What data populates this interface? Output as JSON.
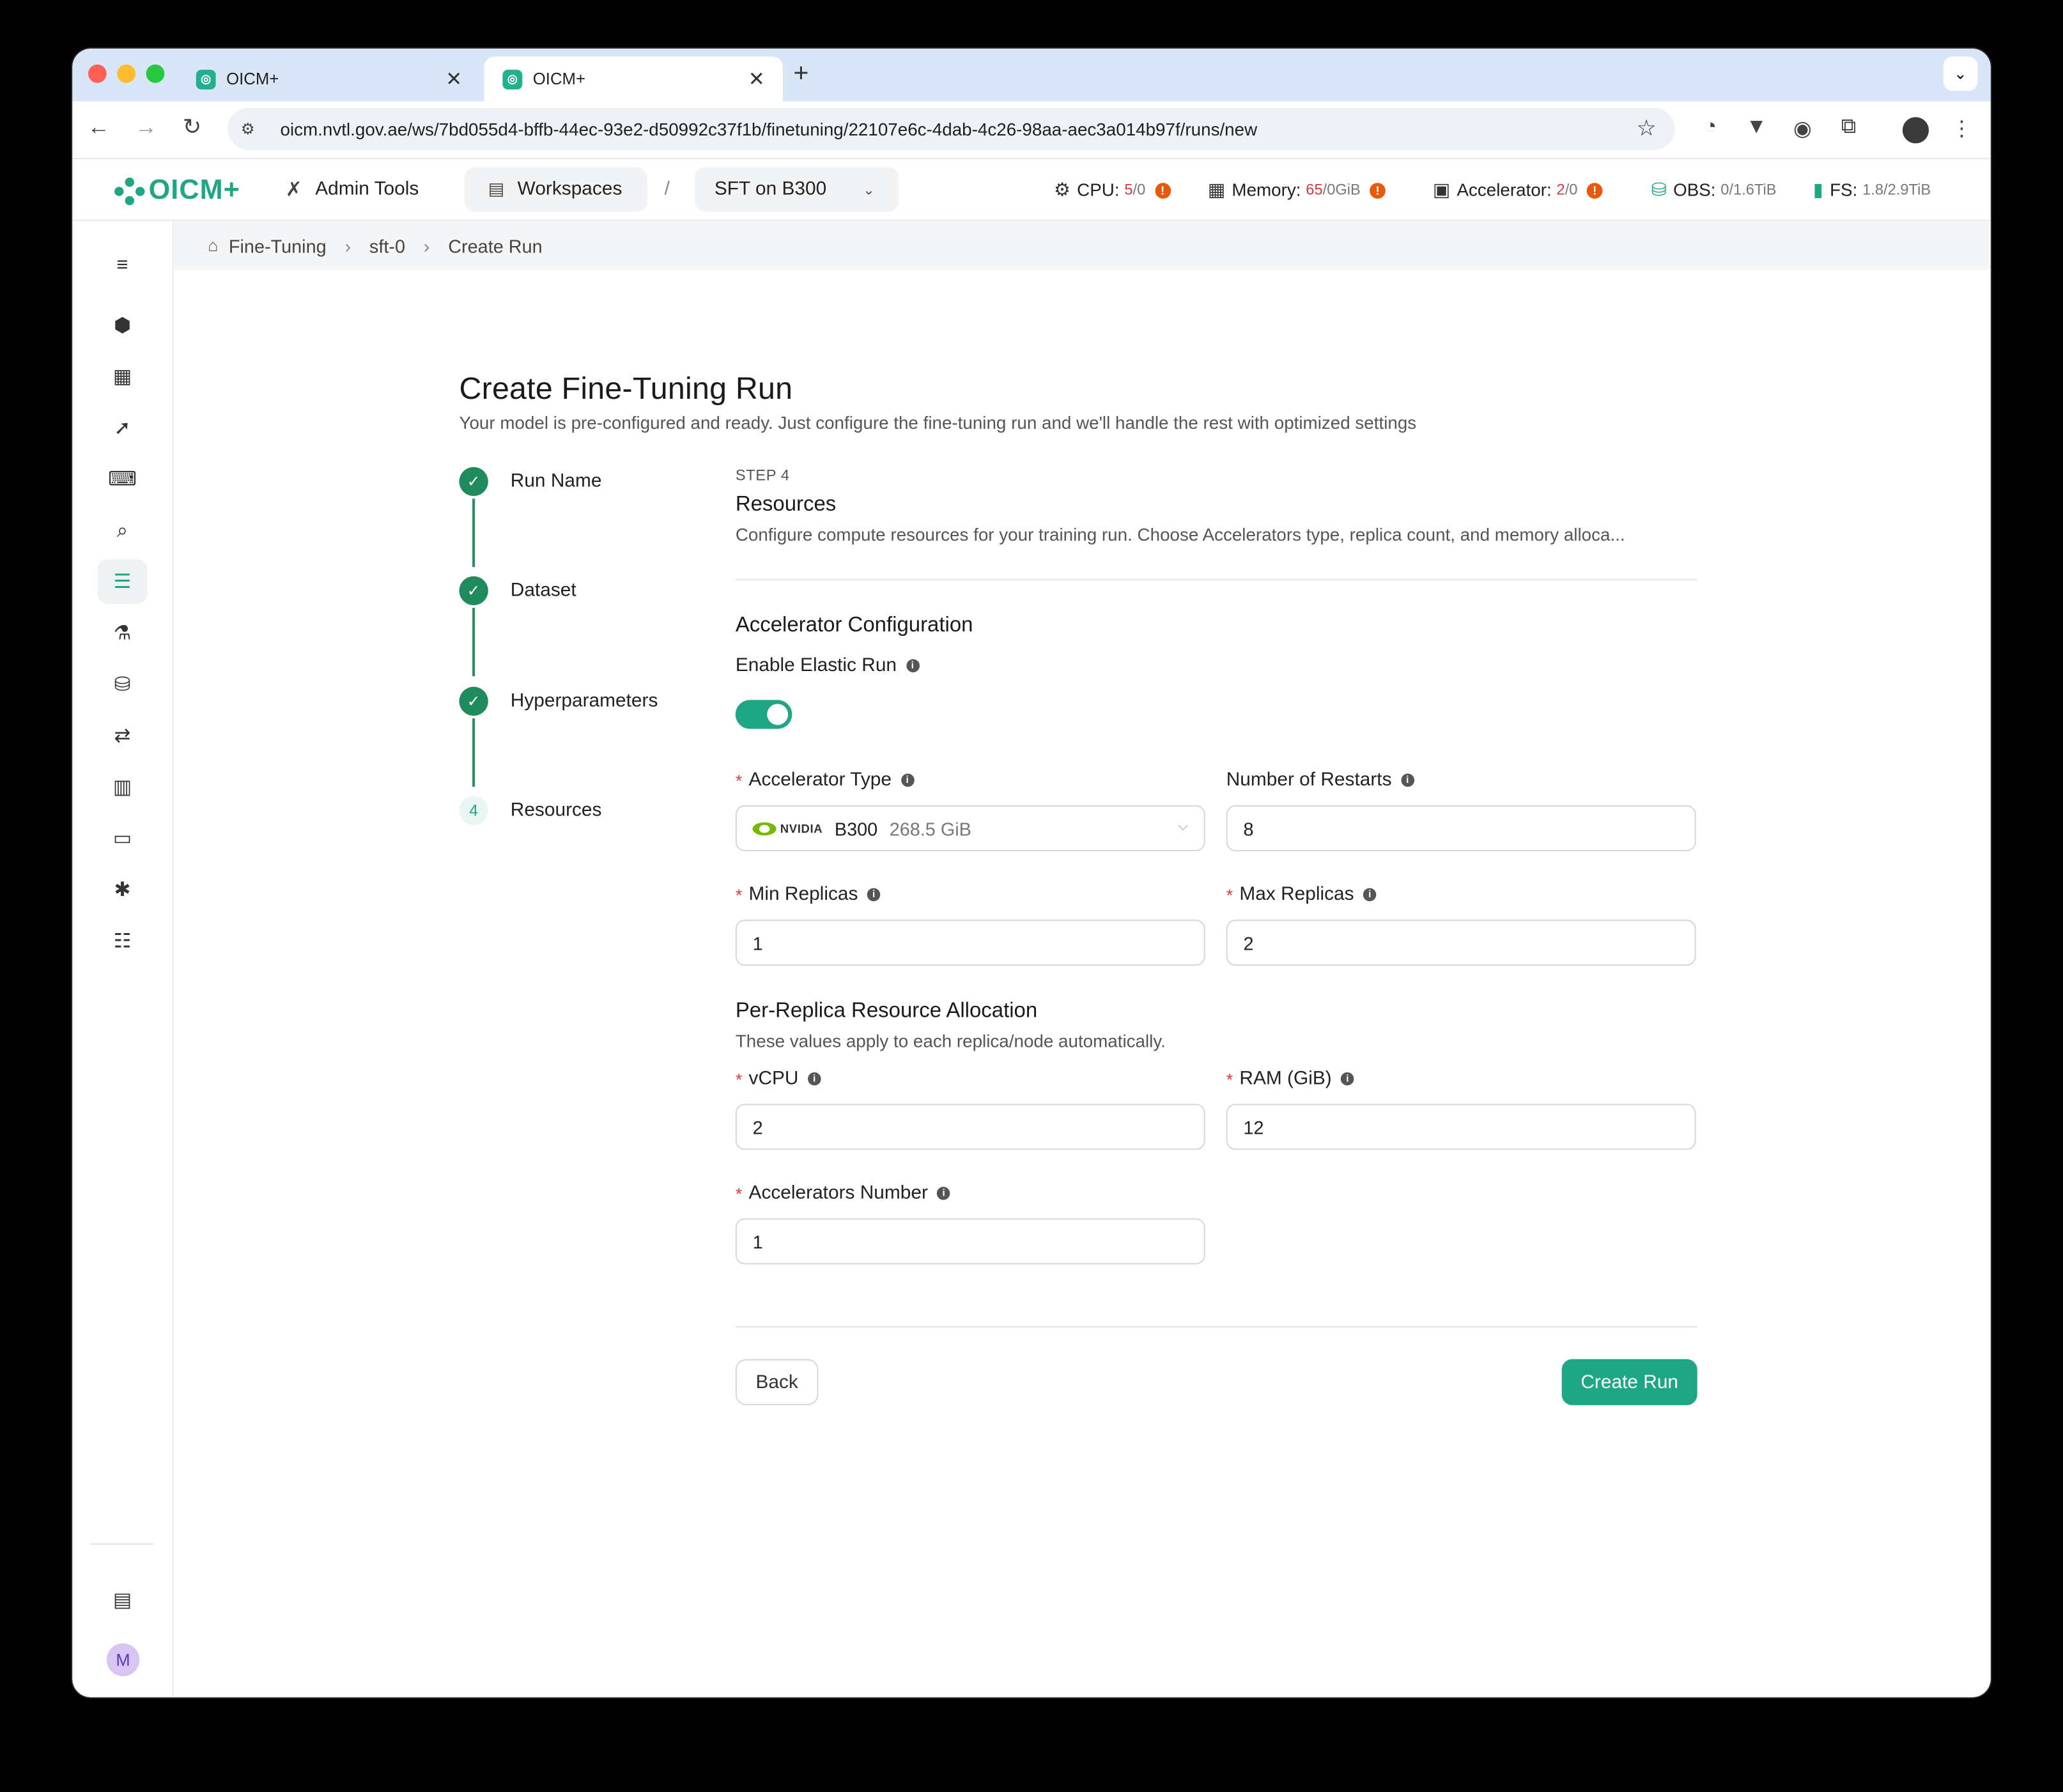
{
  "browser": {
    "tabs": [
      {
        "title": "OICM+",
        "active": false
      },
      {
        "title": "OICM+",
        "active": true
      }
    ],
    "url": "oicm.nvtl.gov.ae/ws/7bd055d4-bffb-44ec-93e2-d50992c37f1b/finetuning/22107e6c-4dab-4c26-98aa-aec3a014b97f/runs/new"
  },
  "header": {
    "logo_text": "OICM+",
    "admin_tools": "Admin Tools",
    "workspaces": "Workspaces",
    "separator": "/",
    "workspace_name": "SFT on B300",
    "resources": {
      "cpu": {
        "label": "CPU:",
        "used": "5",
        "total": "/0"
      },
      "memory": {
        "label": "Memory:",
        "used": "65",
        "total": "/0GiB"
      },
      "accelerator": {
        "label": "Accelerator:",
        "used": "2",
        "total": "/0"
      },
      "obs": {
        "label": "OBS:",
        "value": "0/1.6TiB"
      },
      "fs": {
        "label": "FS:",
        "value": "1.8/2.9TiB"
      }
    },
    "warn_glyph": "!"
  },
  "breadcrumb": {
    "items": [
      "Fine-Tuning",
      "sft-0",
      "Create Run"
    ]
  },
  "page": {
    "title": "Create Fine-Tuning Run",
    "subtitle": "Your model is pre-configured and ready. Just configure the fine-tuning run and we'll handle the rest with optimized settings"
  },
  "stepper": {
    "steps": [
      {
        "label": "Run Name",
        "status": "done"
      },
      {
        "label": "Dataset",
        "status": "done"
      },
      {
        "label": "Hyperparameters",
        "status": "done"
      },
      {
        "label": "Resources",
        "status": "current",
        "number": "4"
      }
    ]
  },
  "form": {
    "step_label": "STEP 4",
    "section_title": "Resources",
    "section_desc": "Configure compute resources for your training run. Choose Accelerators type, replica count, and memory alloca...",
    "accel_config_title": "Accelerator Configuration",
    "elastic_label": "Enable Elastic Run",
    "elastic_enabled": true,
    "accel_type_label": "Accelerator Type",
    "accel_type_brand": "NVIDIA",
    "accel_type_value": "B300",
    "accel_type_mem": "268.5 GiB",
    "restarts_label": "Number of Restarts",
    "restarts_value": "8",
    "min_replicas_label": "Min Replicas",
    "min_replicas_value": "1",
    "max_replicas_label": "Max Replicas",
    "max_replicas_value": "2",
    "per_replica_title": "Per-Replica Resource Allocation",
    "per_replica_desc": "These values apply to each replica/node automatically.",
    "vcpu_label": "vCPU",
    "vcpu_value": "2",
    "ram_label": "RAM (GiB)",
    "ram_value": "12",
    "accel_num_label": "Accelerators Number",
    "accel_num_value": "1",
    "required_mark": "*",
    "info_glyph": "i"
  },
  "actions": {
    "back": "Back",
    "create": "Create Run"
  },
  "user": {
    "avatar_initial": "M"
  },
  "colors": {
    "accent": "#1fa785",
    "done_step": "#1f8a5b",
    "warning": "#e8590c",
    "danger": "#e03b3b"
  }
}
